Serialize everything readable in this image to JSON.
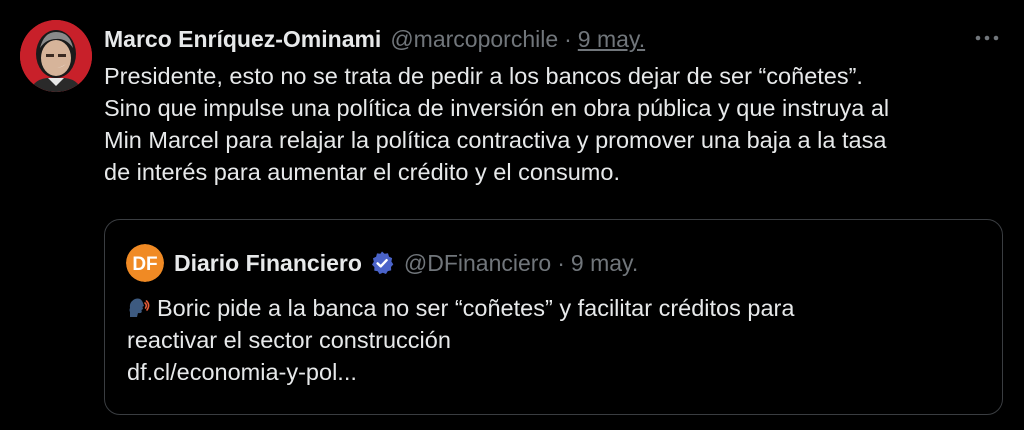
{
  "tweet": {
    "author": {
      "display_name": "Marco Enríquez-Ominami",
      "handle": "@marcoporchile",
      "separator": "·",
      "date": "9 may.",
      "avatar_color": "#c8202a"
    },
    "text_lines": [
      "Presidente, esto no se trata de pedir a los bancos dejar de ser “coñetes”.",
      "Sino que impulse una política de inversión en obra pública y que instruya al",
      "Min Marcel para relajar la política contractiva y promover una baja a la tasa",
      "de interés para aumentar el crédito y el consumo."
    ],
    "more_icon": "more-horizontal-icon"
  },
  "quoted": {
    "avatar_text": "DF",
    "avatar_color": "#f08a24",
    "display_name": "Diario Financiero",
    "verified_icon": "verified-badge-icon",
    "verified_color": "#4a63c9",
    "handle": "@DFinanciero",
    "separator": "·",
    "date": "9 may.",
    "emoji": "speaking-head-emoji",
    "text_line_1": "Boric pide a la banca no ser “coñetes” y facilitar créditos para",
    "text_line_2": "reactivar el sector construcción",
    "link": "df.cl/economia-y-pol..."
  },
  "colors": {
    "background": "#000000",
    "text": "#e7e9ea",
    "muted": "#71767b",
    "border": "#3a3d41"
  }
}
